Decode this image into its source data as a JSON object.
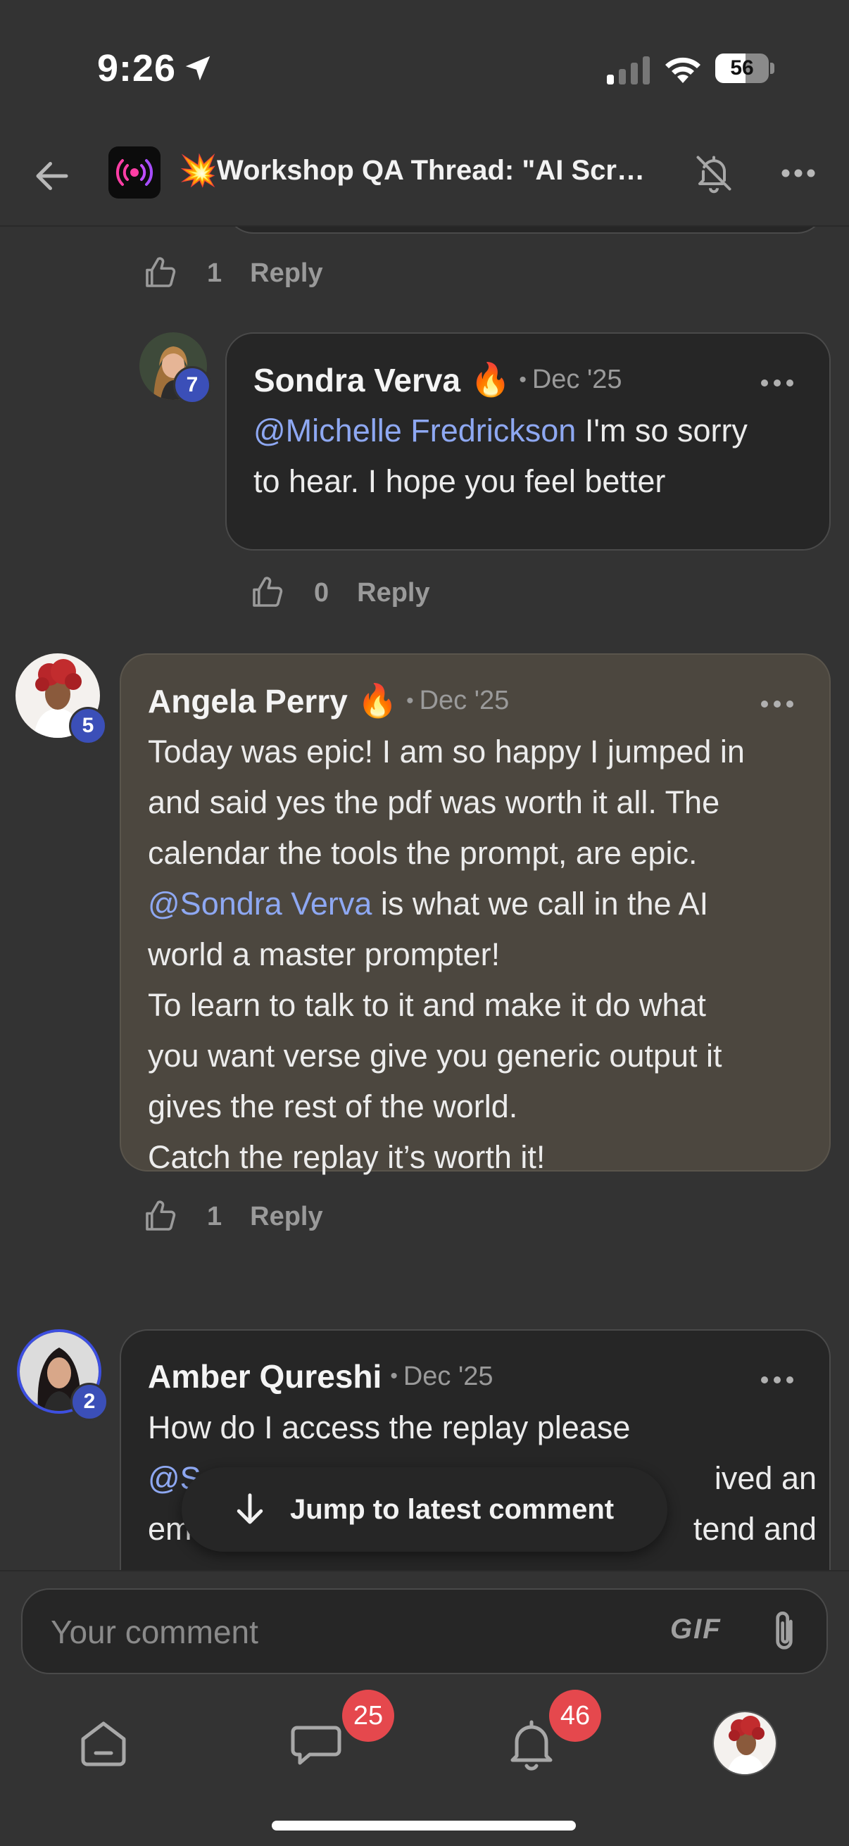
{
  "status_bar": {
    "time": "9:26",
    "battery": "56",
    "battery_level": 0.56
  },
  "header": {
    "title_emoji": "💥",
    "title": "Workshop QA Thread: \"AI Scrol...",
    "back_icon": "arrow-left-icon",
    "notification_icon": "bell-slash-icon",
    "more_icon": "more-horizontal-icon"
  },
  "thread": {
    "top_reply_actions": {
      "likes": "1",
      "reply_label": "Reply"
    },
    "comments": [
      {
        "author": "Sondra Verva",
        "author_emoji": "🔥",
        "separator": "•",
        "date": "Dec '25",
        "level": "7",
        "body_mention": "@Michelle Fredrickson",
        "body_lines": [
          "I'm so sorry",
          "to hear. I hope you feel better"
        ],
        "likes": "0",
        "reply_label": "Reply"
      },
      {
        "author": "Angela Perry",
        "author_emoji": "🔥",
        "separator": "•",
        "date": "Dec '25",
        "level": "5",
        "body_lines_before": [
          "Today was epic! I am so happy I jumped in",
          "and said yes the pdf was worth it all. The",
          "calendar the tools the prompt, are epic."
        ],
        "body_mention": "@Sondra Verva",
        "body_after_mention": "is what we call in the AI",
        "body_lines_after": [
          "world a master prompter!",
          "To learn to talk to it and make it do what",
          "you want verse give you generic output it",
          "gives the rest of the world.",
          "Catch the replay it’s worth it!"
        ],
        "likes": "1",
        "reply_label": "Reply"
      },
      {
        "author": "Amber Qureshi",
        "separator": "•",
        "date": "Dec '25",
        "level": "2",
        "body_line_1": "How do I access the replay please",
        "body_line_2_mention": "@S",
        "body_line_2_rest": "ived an",
        "body_line_3_start": "em",
        "body_line_3_rest": "tend and"
      }
    ]
  },
  "jump_button": {
    "label": "Jump to latest comment",
    "icon": "arrow-down-icon"
  },
  "composer": {
    "placeholder": "Your comment",
    "gif_label": "GIF",
    "attach_icon": "paperclip-icon"
  },
  "tab_bar": {
    "home_icon": "home-icon",
    "chat_icon": "chat-bubble-icon",
    "chat_count": "25",
    "notifications_icon": "bell-icon",
    "notifications_count": "46",
    "profile": "avatar"
  },
  "colors": {
    "background": "#333333",
    "bubble_dark": "#262626",
    "bubble_highlight": "#4c473f",
    "mention": "#8ea8f2",
    "badge_red": "#e5484d",
    "level_badge": "#3b4fb8"
  }
}
